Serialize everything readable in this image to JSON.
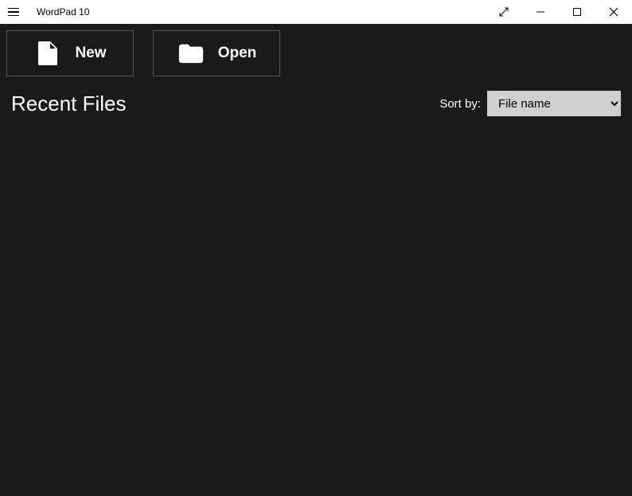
{
  "titleBar": {
    "appTitle": "WordPad 10"
  },
  "actions": {
    "newLabel": "New",
    "openLabel": "Open"
  },
  "recent": {
    "heading": "Recent Files",
    "sortLabel": "Sort by:",
    "sortSelected": "File name"
  }
}
